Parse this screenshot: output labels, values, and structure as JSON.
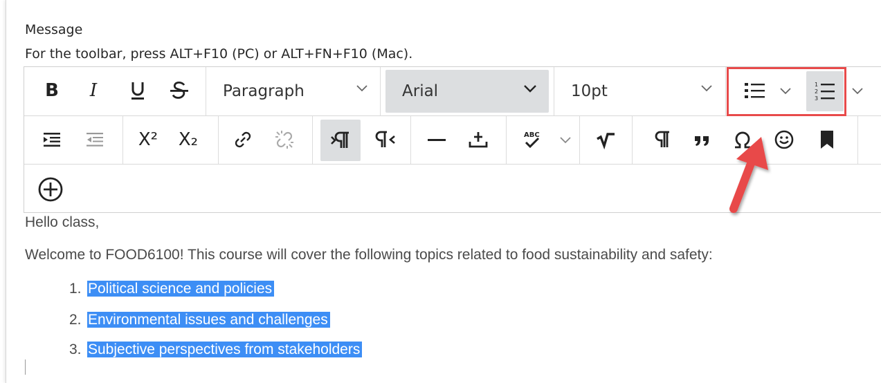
{
  "field": {
    "title": "Message",
    "hint": "For the toolbar, press ALT+F10 (PC) or ALT+FN+F10 (Mac)."
  },
  "toolbar": {
    "bold": "B",
    "italic": "I",
    "block_format": "Paragraph",
    "font_family": "Arial",
    "font_size": "10pt",
    "superscript": "X²",
    "subscript": "X₂",
    "icons": {
      "bullet_list": "bulleted-list-icon",
      "numbered_list": "numbered-list-icon",
      "indent": "indent-icon",
      "outdent": "outdent-icon",
      "link": "link-icon",
      "unlink": "unlink-icon",
      "ltr": "left-to-right-icon",
      "rtl": "right-to-left-icon",
      "hr": "horizontal-line-icon",
      "anchor": "insert-anchor-icon",
      "spellcheck": "spellcheck-icon",
      "math": "math-equation-icon",
      "show_blocks": "pilcrow-icon",
      "blockquote": "blockquote-icon",
      "special_char": "omega-icon",
      "emoticons": "smiley-icon",
      "bookmark": "bookmark-icon",
      "add_content": "add-circle-icon"
    },
    "spellcheck_text": "ABC"
  },
  "content": {
    "greeting": "Hello class,",
    "intro": "Welcome to FOOD6100! This course will cover the following topics related to food sustainability and safety:",
    "list": [
      {
        "num": "1.",
        "text": "Political science and policies"
      },
      {
        "num": "2.",
        "text": "Environmental issues and challenges"
      },
      {
        "num": "3.",
        "text": "Subjective perspectives from stakeholders"
      }
    ]
  },
  "colors": {
    "highlight_box": "#e84a4a",
    "arrow": "#e84a4a",
    "selection": "#3d8ef5",
    "pressed_button": "#dcdee0"
  }
}
